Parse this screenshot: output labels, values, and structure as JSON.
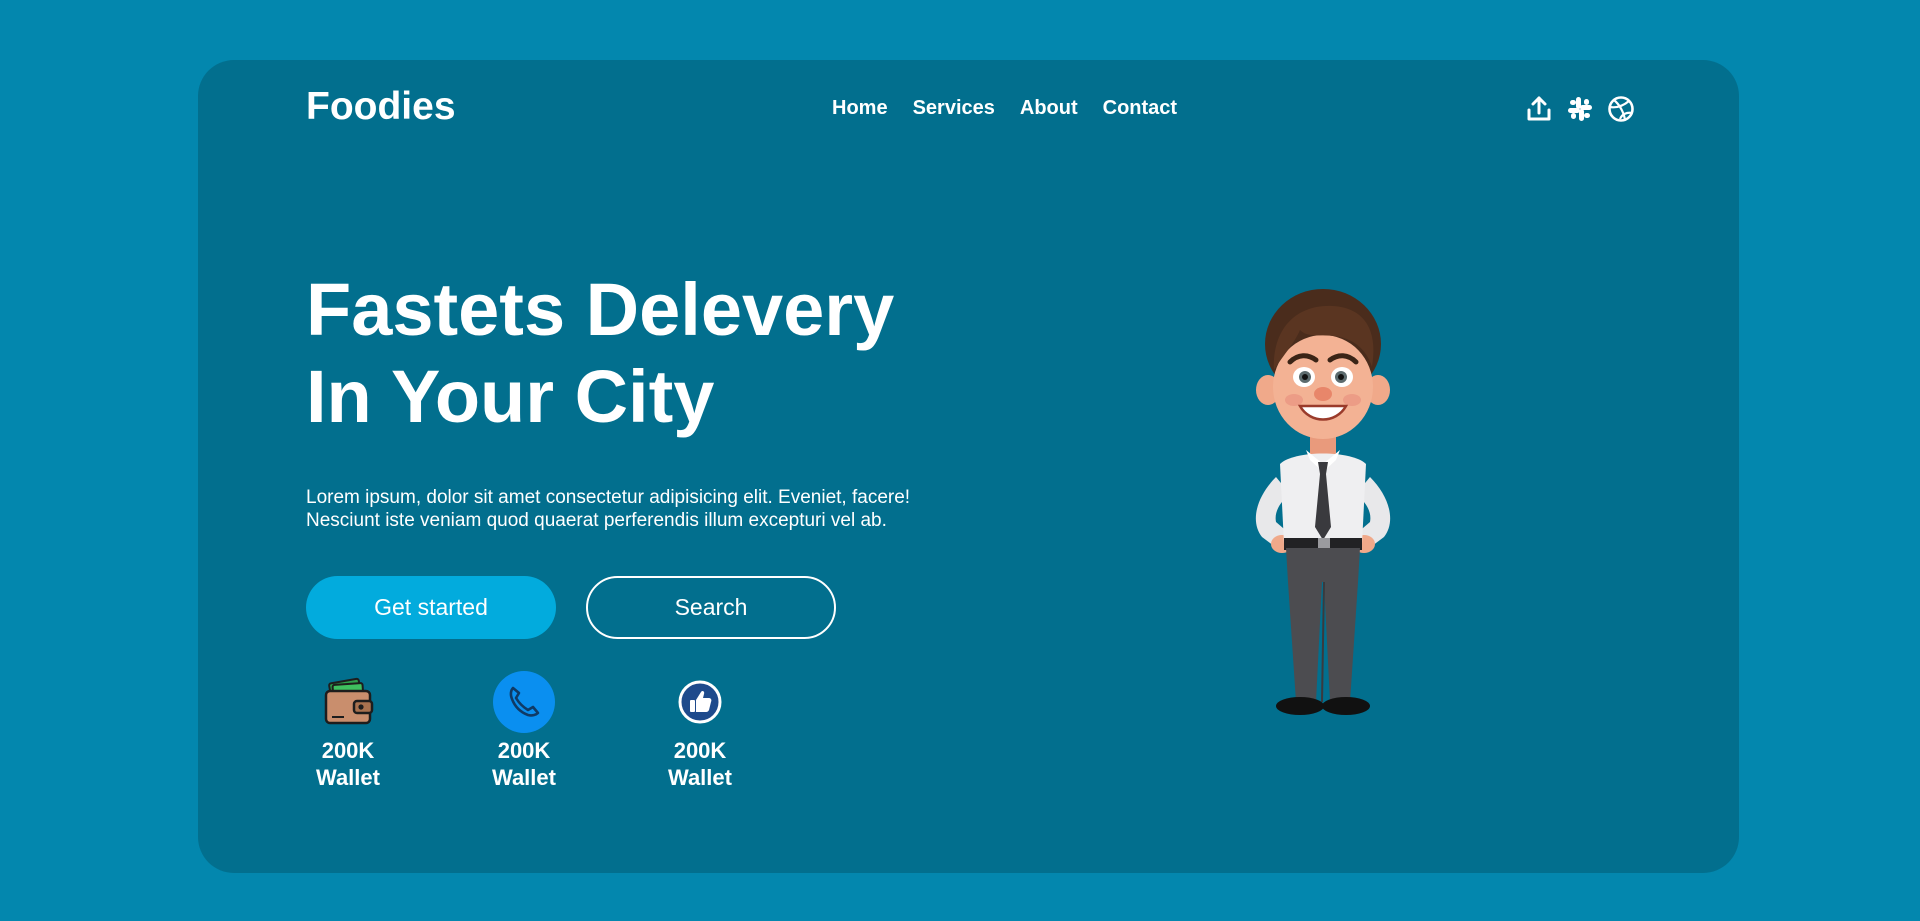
{
  "brand": {
    "name": "Foodies"
  },
  "nav": {
    "items": [
      {
        "label": "Home"
      },
      {
        "label": "Services"
      },
      {
        "label": "About"
      },
      {
        "label": "Contact"
      }
    ]
  },
  "social": {
    "icons": [
      "upload-icon",
      "slack-icon",
      "dribbble-icon"
    ]
  },
  "hero": {
    "title_line1": "Fastets Delevery",
    "title_line2": "In Your City",
    "description_line1": "Lorem ipsum, dolor sit amet consectetur adipisicing elit. Eveniet, facere!",
    "description_line2": "Nesciunt iste veniam quod quaerat perferendis illum excepturi vel ab.",
    "primary_button": "Get started",
    "secondary_button": "Search"
  },
  "stats": [
    {
      "icon": "wallet-icon",
      "value": "200K",
      "label": "Wallet"
    },
    {
      "icon": "phone-icon",
      "value": "200K",
      "label": "Wallet"
    },
    {
      "icon": "thumbs-up-icon",
      "value": "200K",
      "label": "Wallet"
    }
  ],
  "colors": {
    "page_background": "#0387ae",
    "card_background": "#026f8e",
    "primary_button": "#02abdd",
    "phone_badge": "#0a8ff0",
    "like_badge": "#1e4a8c",
    "text": "#ffffff"
  }
}
